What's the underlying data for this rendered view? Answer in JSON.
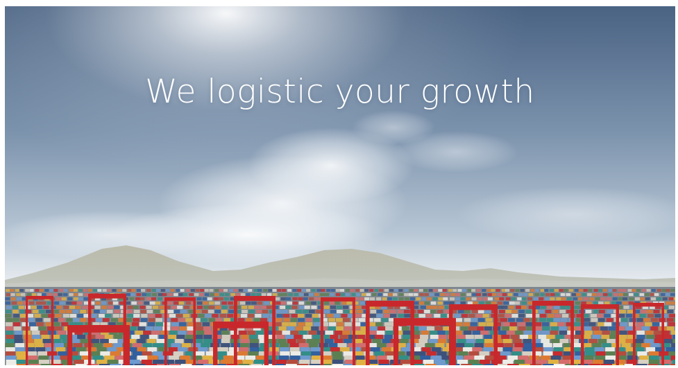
{
  "hero": {
    "headline": "We logistic your growth",
    "scene": "container-port-landscape"
  },
  "colors": {
    "sky_top": "#47607e",
    "sky_mid": "#9fb3c9",
    "haze": "#dfe6ec",
    "mountain": "#a7a99a",
    "container_red": "#c8282b",
    "container_blue": "#2f5e9e",
    "container_orange": "#e07a2e",
    "container_teal": "#2f8f86",
    "text": "#ffffff"
  }
}
